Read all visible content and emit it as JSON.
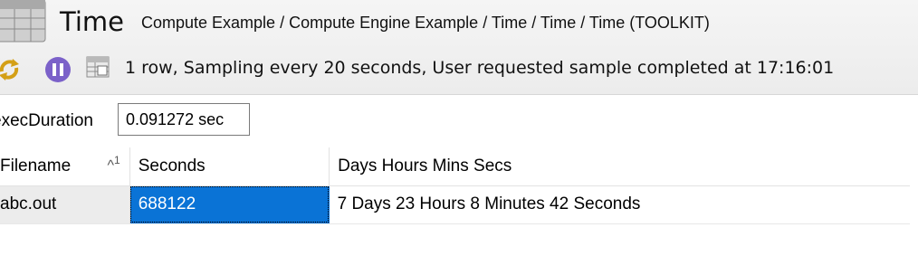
{
  "header": {
    "title": "Time",
    "breadcrumb": "Compute Example / Compute Engine Example / Time / Time / Time (TOOLKIT)"
  },
  "toolbar": {
    "icons": [
      "refresh-icon",
      "pause-icon",
      "grid-icon"
    ],
    "status": "1 row, Sampling every 20 seconds, User requested sample completed at 17:16:01"
  },
  "param": {
    "label": "execDuration",
    "value": "0.091272 sec"
  },
  "table": {
    "columns": [
      "Filename",
      "Seconds",
      "Days Hours Mins Secs"
    ],
    "sort": {
      "arrow": "^",
      "index": "1"
    },
    "rows": [
      {
        "filename": "abc.out",
        "seconds": "688122",
        "dhms": "7 Days 23 Hours 8 Minutes 42 Seconds"
      }
    ]
  },
  "colors": {
    "selection": "#0a73d6",
    "pause": "#7b61c9"
  }
}
